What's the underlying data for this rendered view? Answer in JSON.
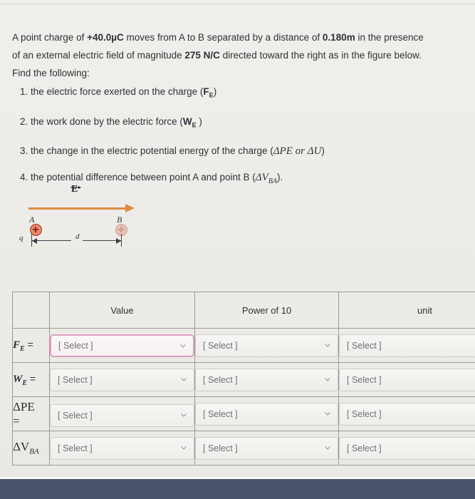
{
  "problem": {
    "line1_a": "A point charge of ",
    "line1_charge": "+40.0µC",
    "line1_b": " moves from A to B separated by a distance of ",
    "line1_distance": "0.180m",
    "line1_c": " in the presence",
    "line2_a": "of an external electric field of magnitude ",
    "line2_field": "275 N/C",
    "line2_b": " directed toward the right as in the figure below.",
    "line3": "Find the following:"
  },
  "questions": [
    {
      "number": "1.",
      "text": "the electric force exerted on the charge (",
      "symbol_main": "F",
      "symbol_sub": "E",
      "close": ")"
    },
    {
      "number": "2.",
      "text": "the work done by the electric force (",
      "symbol_main": "W",
      "symbol_sub": "E",
      "close": ")"
    },
    {
      "number": "3.",
      "text": "the change in the electric potential energy of the charge (",
      "symbol_math": "ΔPE or ΔU",
      "close": ")"
    },
    {
      "number": "4.",
      "text": "the potential difference between point A and point B  (",
      "symbol_math_main": "ΔV",
      "symbol_math_sub": "BA",
      "close": ")."
    }
  ],
  "figure": {
    "field_label": "E",
    "point_a_label": "A",
    "point_b_label": "B",
    "charge_label": "q",
    "distance_label": "d",
    "field_arrow_color": "#e08b3f",
    "charge_color": "#e8896f",
    "charge_border_color": "#9c3a23",
    "charge_sign": "+"
  },
  "table": {
    "headers": {
      "blank": "",
      "value": "Value",
      "power": "Power of 10",
      "unit": "unit"
    },
    "rows": [
      {
        "label_main": "F",
        "label_sub": "E",
        "label_eq": " =",
        "value": "[ Select ]",
        "power": "[ Select ]",
        "unit": "[ Select ]",
        "value_focused": true
      },
      {
        "label_main": "W",
        "label_sub": "E",
        "label_eq": " =",
        "value": "[ Select ]",
        "power": "[ Select ]",
        "unit": "[ Select ]",
        "value_focused": false
      },
      {
        "label_serif": "ΔPE",
        "label_eq2": "=",
        "value": "[ Select ]",
        "power": "[ Select ]",
        "unit": "[ Select ]",
        "value_focused": false
      },
      {
        "label_serif": "ΔV",
        "label_serif_sub": "BA",
        "value": "[ Select ]",
        "power": "[ Select ]",
        "unit": "[ Select ]",
        "value_focused": false
      }
    ]
  },
  "chrome": {
    "bottom_bar_color": "#49536b",
    "page_background": "#edece8"
  }
}
